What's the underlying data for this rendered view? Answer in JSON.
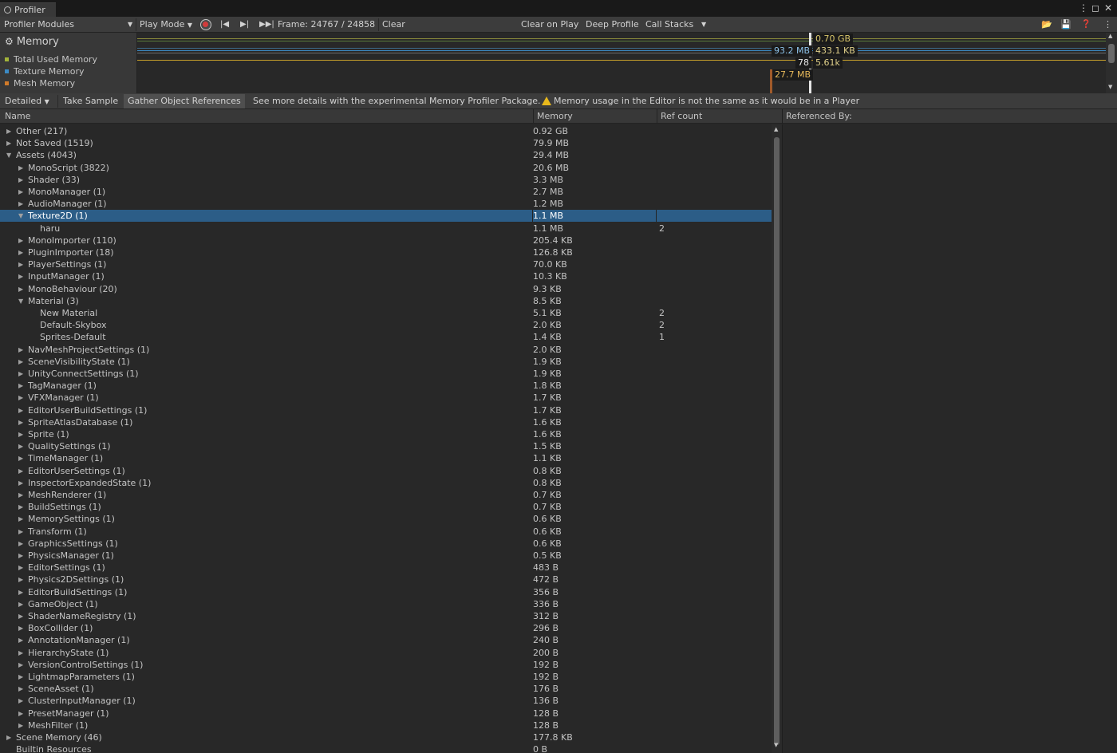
{
  "window": {
    "tab_title": "Profiler"
  },
  "toolbar": {
    "modules_label": "Profiler Modules",
    "play_mode": "Play Mode",
    "frame": "Frame: 24767 / 24858",
    "clear": "Clear",
    "clear_on_play": "Clear on Play",
    "deep_profile": "Deep Profile",
    "call_stacks": "Call Stacks"
  },
  "module": {
    "title": "Memory",
    "legend": [
      {
        "label": "Total Used Memory",
        "color": "#a3b43a"
      },
      {
        "label": "Texture Memory",
        "color": "#3c8ac4"
      },
      {
        "label": "Mesh Memory",
        "color": "#d07a2a"
      }
    ]
  },
  "graph": {
    "labels": [
      "0.70 GB",
      "93.2 MB",
      "433.1 KB",
      "78",
      "5.61k",
      "27.7 MB"
    ]
  },
  "subbar": {
    "view_mode": "Detailed",
    "take_sample": "Take Sample",
    "gather_refs": "Gather Object References",
    "info": "See more details with the experimental Memory Profiler Package.",
    "warning": "Memory usage in the Editor is not the same as it would be in a Player"
  },
  "columns": {
    "name": "Name",
    "memory": "Memory",
    "refcount": "Ref count",
    "referenced_by": "Referenced By:"
  },
  "rows": [
    {
      "name": "Other (217)",
      "memory": "0.92 GB",
      "refcount": "",
      "depth": 0,
      "arrow": "collapsed"
    },
    {
      "name": "Not Saved (1519)",
      "memory": "79.9 MB",
      "refcount": "",
      "depth": 0,
      "arrow": "collapsed"
    },
    {
      "name": "Assets (4043)",
      "memory": "29.4 MB",
      "refcount": "",
      "depth": 0,
      "arrow": "expanded"
    },
    {
      "name": "MonoScript (3822)",
      "memory": "20.6 MB",
      "refcount": "",
      "depth": 1,
      "arrow": "collapsed"
    },
    {
      "name": "Shader (33)",
      "memory": "3.3 MB",
      "refcount": "",
      "depth": 1,
      "arrow": "collapsed"
    },
    {
      "name": "MonoManager (1)",
      "memory": "2.7 MB",
      "refcount": "",
      "depth": 1,
      "arrow": "collapsed"
    },
    {
      "name": "AudioManager (1)",
      "memory": "1.2 MB",
      "refcount": "",
      "depth": 1,
      "arrow": "collapsed"
    },
    {
      "name": "Texture2D (1)",
      "memory": "1.1 MB",
      "refcount": "",
      "depth": 1,
      "arrow": "expanded",
      "selected": true
    },
    {
      "name": "haru",
      "memory": "1.1 MB",
      "refcount": "2",
      "depth": 2,
      "arrow": ""
    },
    {
      "name": "MonoImporter (110)",
      "memory": "205.4 KB",
      "refcount": "",
      "depth": 1,
      "arrow": "collapsed"
    },
    {
      "name": "PluginImporter (18)",
      "memory": "126.8 KB",
      "refcount": "",
      "depth": 1,
      "arrow": "collapsed"
    },
    {
      "name": "PlayerSettings (1)",
      "memory": "70.0 KB",
      "refcount": "",
      "depth": 1,
      "arrow": "collapsed"
    },
    {
      "name": "InputManager (1)",
      "memory": "10.3 KB",
      "refcount": "",
      "depth": 1,
      "arrow": "collapsed"
    },
    {
      "name": "MonoBehaviour (20)",
      "memory": "9.3 KB",
      "refcount": "",
      "depth": 1,
      "arrow": "collapsed"
    },
    {
      "name": "Material (3)",
      "memory": "8.5 KB",
      "refcount": "",
      "depth": 1,
      "arrow": "expanded"
    },
    {
      "name": "New Material",
      "memory": "5.1 KB",
      "refcount": "2",
      "depth": 2,
      "arrow": ""
    },
    {
      "name": "Default-Skybox",
      "memory": "2.0 KB",
      "refcount": "2",
      "depth": 2,
      "arrow": ""
    },
    {
      "name": "Sprites-Default",
      "memory": "1.4 KB",
      "refcount": "1",
      "depth": 2,
      "arrow": ""
    },
    {
      "name": "NavMeshProjectSettings (1)",
      "memory": "2.0 KB",
      "refcount": "",
      "depth": 1,
      "arrow": "collapsed"
    },
    {
      "name": "SceneVisibilityState (1)",
      "memory": "1.9 KB",
      "refcount": "",
      "depth": 1,
      "arrow": "collapsed"
    },
    {
      "name": "UnityConnectSettings (1)",
      "memory": "1.9 KB",
      "refcount": "",
      "depth": 1,
      "arrow": "collapsed"
    },
    {
      "name": "TagManager (1)",
      "memory": "1.8 KB",
      "refcount": "",
      "depth": 1,
      "arrow": "collapsed"
    },
    {
      "name": "VFXManager (1)",
      "memory": "1.7 KB",
      "refcount": "",
      "depth": 1,
      "arrow": "collapsed"
    },
    {
      "name": "EditorUserBuildSettings (1)",
      "memory": "1.7 KB",
      "refcount": "",
      "depth": 1,
      "arrow": "collapsed"
    },
    {
      "name": "SpriteAtlasDatabase (1)",
      "memory": "1.6 KB",
      "refcount": "",
      "depth": 1,
      "arrow": "collapsed"
    },
    {
      "name": "Sprite (1)",
      "memory": "1.6 KB",
      "refcount": "",
      "depth": 1,
      "arrow": "collapsed"
    },
    {
      "name": "QualitySettings (1)",
      "memory": "1.5 KB",
      "refcount": "",
      "depth": 1,
      "arrow": "collapsed"
    },
    {
      "name": "TimeManager (1)",
      "memory": "1.1 KB",
      "refcount": "",
      "depth": 1,
      "arrow": "collapsed"
    },
    {
      "name": "EditorUserSettings (1)",
      "memory": "0.8 KB",
      "refcount": "",
      "depth": 1,
      "arrow": "collapsed"
    },
    {
      "name": "InspectorExpandedState (1)",
      "memory": "0.8 KB",
      "refcount": "",
      "depth": 1,
      "arrow": "collapsed"
    },
    {
      "name": "MeshRenderer (1)",
      "memory": "0.7 KB",
      "refcount": "",
      "depth": 1,
      "arrow": "collapsed"
    },
    {
      "name": "BuildSettings (1)",
      "memory": "0.7 KB",
      "refcount": "",
      "depth": 1,
      "arrow": "collapsed"
    },
    {
      "name": "MemorySettings (1)",
      "memory": "0.6 KB",
      "refcount": "",
      "depth": 1,
      "arrow": "collapsed"
    },
    {
      "name": "Transform (1)",
      "memory": "0.6 KB",
      "refcount": "",
      "depth": 1,
      "arrow": "collapsed"
    },
    {
      "name": "GraphicsSettings (1)",
      "memory": "0.6 KB",
      "refcount": "",
      "depth": 1,
      "arrow": "collapsed"
    },
    {
      "name": "PhysicsManager (1)",
      "memory": "0.5 KB",
      "refcount": "",
      "depth": 1,
      "arrow": "collapsed"
    },
    {
      "name": "EditorSettings (1)",
      "memory": "483 B",
      "refcount": "",
      "depth": 1,
      "arrow": "collapsed"
    },
    {
      "name": "Physics2DSettings (1)",
      "memory": "472 B",
      "refcount": "",
      "depth": 1,
      "arrow": "collapsed"
    },
    {
      "name": "EditorBuildSettings (1)",
      "memory": "356 B",
      "refcount": "",
      "depth": 1,
      "arrow": "collapsed"
    },
    {
      "name": "GameObject (1)",
      "memory": "336 B",
      "refcount": "",
      "depth": 1,
      "arrow": "collapsed"
    },
    {
      "name": "ShaderNameRegistry (1)",
      "memory": "312 B",
      "refcount": "",
      "depth": 1,
      "arrow": "collapsed"
    },
    {
      "name": "BoxCollider (1)",
      "memory": "296 B",
      "refcount": "",
      "depth": 1,
      "arrow": "collapsed"
    },
    {
      "name": "AnnotationManager (1)",
      "memory": "240 B",
      "refcount": "",
      "depth": 1,
      "arrow": "collapsed"
    },
    {
      "name": "HierarchyState (1)",
      "memory": "200 B",
      "refcount": "",
      "depth": 1,
      "arrow": "collapsed"
    },
    {
      "name": "VersionControlSettings (1)",
      "memory": "192 B",
      "refcount": "",
      "depth": 1,
      "arrow": "collapsed"
    },
    {
      "name": "LightmapParameters (1)",
      "memory": "192 B",
      "refcount": "",
      "depth": 1,
      "arrow": "collapsed"
    },
    {
      "name": "SceneAsset (1)",
      "memory": "176 B",
      "refcount": "",
      "depth": 1,
      "arrow": "collapsed"
    },
    {
      "name": "ClusterInputManager (1)",
      "memory": "136 B",
      "refcount": "",
      "depth": 1,
      "arrow": "collapsed"
    },
    {
      "name": "PresetManager (1)",
      "memory": "128 B",
      "refcount": "",
      "depth": 1,
      "arrow": "collapsed"
    },
    {
      "name": "MeshFilter (1)",
      "memory": "128 B",
      "refcount": "",
      "depth": 1,
      "arrow": "collapsed"
    },
    {
      "name": "Scene Memory (46)",
      "memory": "177.8 KB",
      "refcount": "",
      "depth": 0,
      "arrow": "collapsed"
    },
    {
      "name": "Builtin Resources",
      "memory": "0 B",
      "refcount": "",
      "depth": 0,
      "arrow": ""
    }
  ]
}
